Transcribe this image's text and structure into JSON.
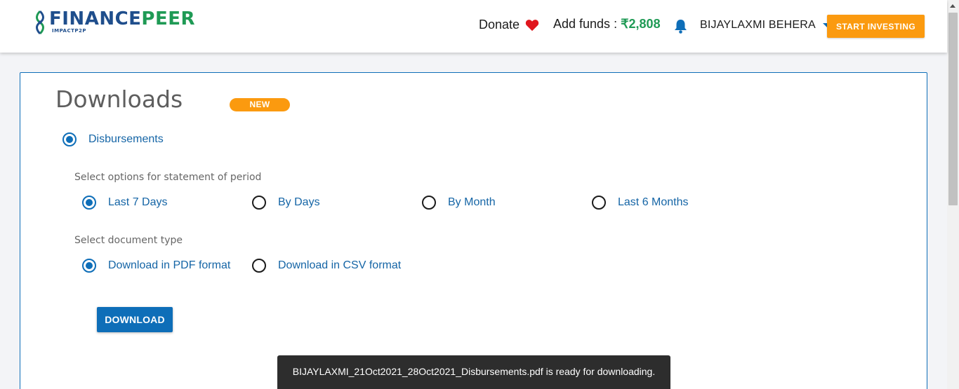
{
  "header": {
    "logo": {
      "text_a": "FINANCE",
      "text_b": "PEER",
      "tagline": "IMPACTP2P"
    },
    "donate_label": "Donate",
    "funds_label": "Add funds : ",
    "funds_amount": "₹2,808",
    "user_name": "BIJAYLAXMI BEHERA",
    "start_investing": "START INVESTING",
    "icons": {
      "donate": "heart-icon",
      "notifications": "bell-icon",
      "user_menu": "caret-down-icon"
    }
  },
  "page": {
    "title": "Downloads",
    "badge": "NEW",
    "statement": {
      "label": "Disbursements",
      "checked": true
    },
    "period": {
      "label": "Select options for statement of period",
      "options": [
        {
          "label": "Last 7 Days",
          "checked": true
        },
        {
          "label": "By Days",
          "checked": false
        },
        {
          "label": "By Month",
          "checked": false
        },
        {
          "label": "Last 6 Months",
          "checked": false
        }
      ]
    },
    "doc_type": {
      "label": "Select document type",
      "options": [
        {
          "label": "Download in PDF format",
          "checked": true
        },
        {
          "label": "Download in CSV format",
          "checked": false
        }
      ]
    },
    "download_button": "DOWNLOAD"
  },
  "toast": {
    "message": "BIJAYLAXMI_21Oct2021_28Oct2021_Disbursements.pdf is ready for downloading."
  },
  "colors": {
    "accent_blue": "#0e6eb8",
    "orange": "#fb9a0f",
    "green": "#1f9a55",
    "heart_red": "#e0161d"
  }
}
